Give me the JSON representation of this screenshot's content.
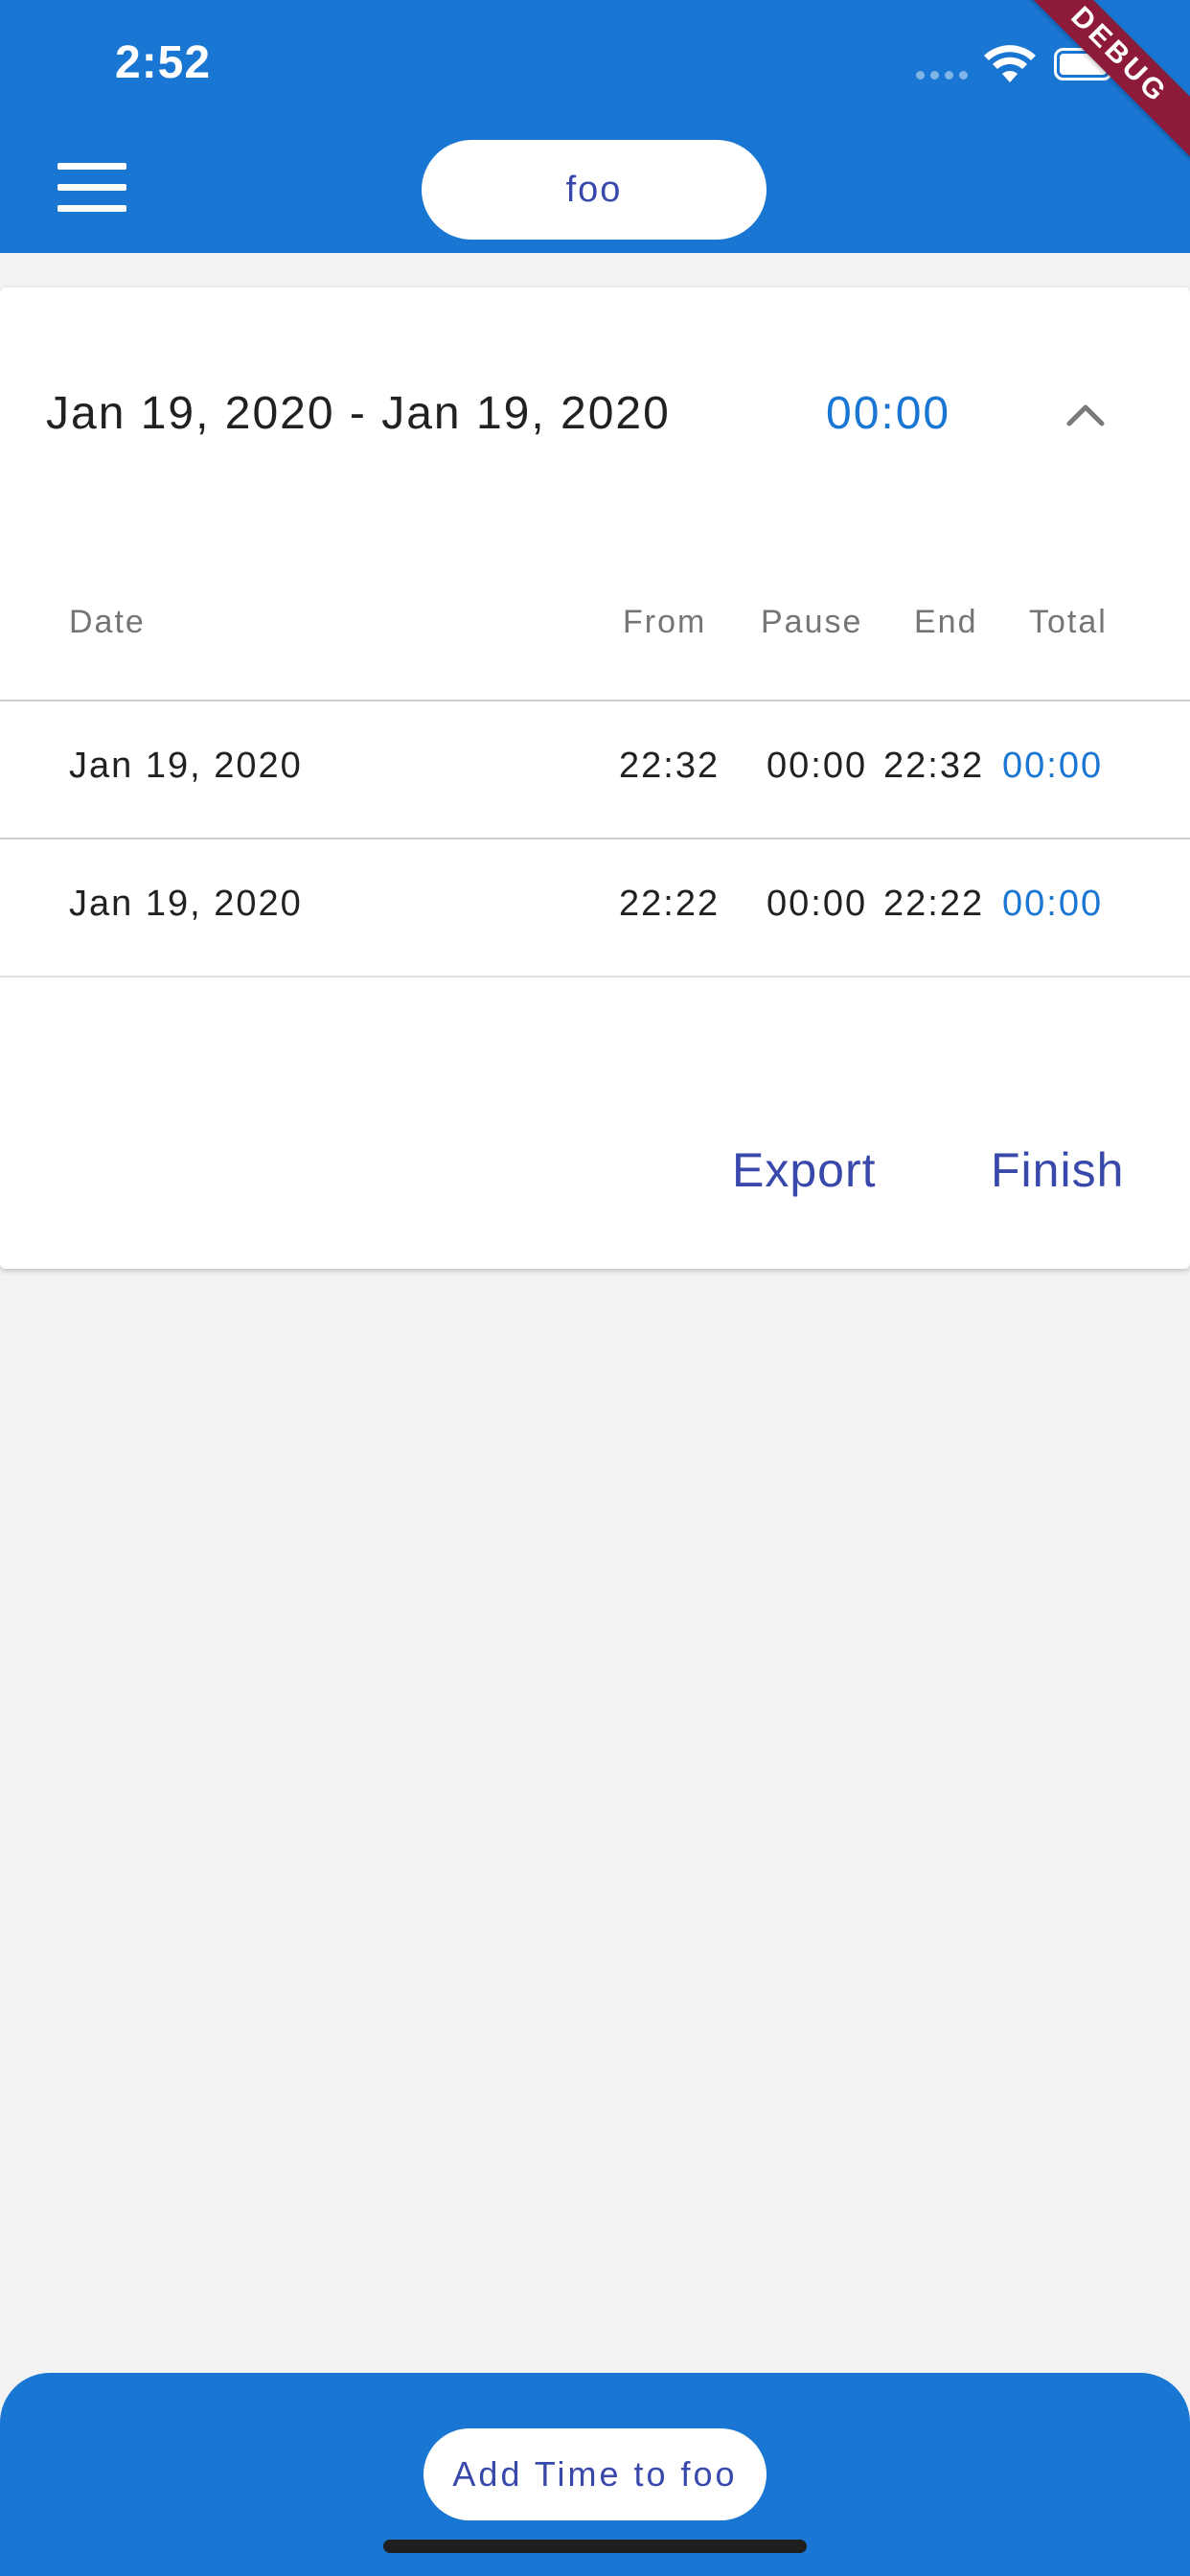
{
  "status_bar": {
    "time": "2:52",
    "icons": [
      "signal-icon",
      "wifi-icon",
      "battery-icon"
    ]
  },
  "debug_banner": "DEBUG",
  "header": {
    "menu_icon": "hamburger-menu-icon",
    "project_name": "foo"
  },
  "card": {
    "range_title": "Jan 19, 2020 - Jan 19, 2020",
    "range_total": "00:00",
    "collapse_icon": "chevron-up-icon",
    "columns": {
      "date": "Date",
      "from": "From",
      "pause": "Pause",
      "end": "End",
      "total": "Total"
    },
    "rows": [
      {
        "date": "Jan 19, 2020",
        "from": "22:32",
        "pause": "00:00",
        "end": "22:32",
        "total": "00:00"
      },
      {
        "date": "Jan 19, 2020",
        "from": "22:22",
        "pause": "00:00",
        "end": "22:22",
        "total": "00:00"
      }
    ],
    "actions": {
      "export_label": "Export",
      "finish_label": "Finish"
    }
  },
  "bottom_bar": {
    "add_time_label": "Add Time to foo"
  },
  "colors": {
    "primary": "#1976d2",
    "button_text": "#3949ab",
    "background": "#f3f3f3",
    "debug_banner": "#8e1a3a"
  }
}
